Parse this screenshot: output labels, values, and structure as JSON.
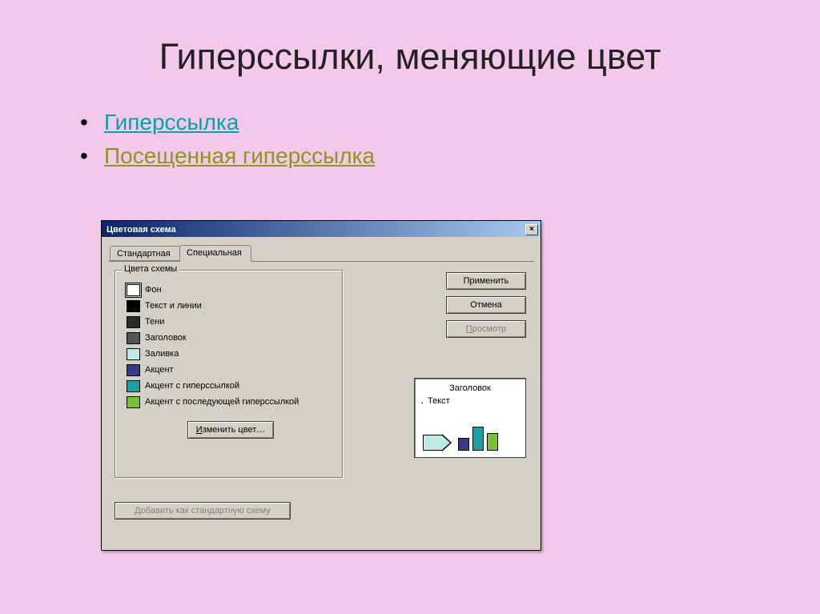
{
  "slide": {
    "title": "Гиперссылки, меняющие цвет",
    "bullets": {
      "hyperlink": "Гиперссылка",
      "visited": "Посещенная гиперссылка"
    }
  },
  "dialog": {
    "title": "Цветовая схема",
    "close": "×",
    "tabs": {
      "standard": "Стандартная",
      "custom": "Специальная"
    },
    "groupbox": "Цвета схемы",
    "colors": [
      {
        "label": "Фон",
        "hex": "#ffffff",
        "selected": true
      },
      {
        "label": "Текст и линии",
        "hex": "#000000"
      },
      {
        "label": "Тени",
        "hex": "#2a2a2a"
      },
      {
        "label": "Заголовок",
        "hex": "#555555"
      },
      {
        "label": "Заливка",
        "hex": "#bfe8e8"
      },
      {
        "label": "Акцент",
        "hex": "#3a3a8c"
      },
      {
        "label": "Акцент с гиперссылкой",
        "hex": "#1aa0a0"
      },
      {
        "label": "Акцент с последующей гиперссылкой",
        "hex": "#78c030"
      }
    ],
    "buttons": {
      "change_color_pre": "И",
      "change_color_rest": "зменить цвет…",
      "apply": "Применить",
      "cancel": "Отмена",
      "preview_pre": "П",
      "preview_rest": "росмотр",
      "add_scheme_pre": "Д",
      "add_scheme_rest": "обавить как стандартную схему"
    },
    "preview": {
      "title": "Заголовок",
      "text": "Текст"
    }
  }
}
